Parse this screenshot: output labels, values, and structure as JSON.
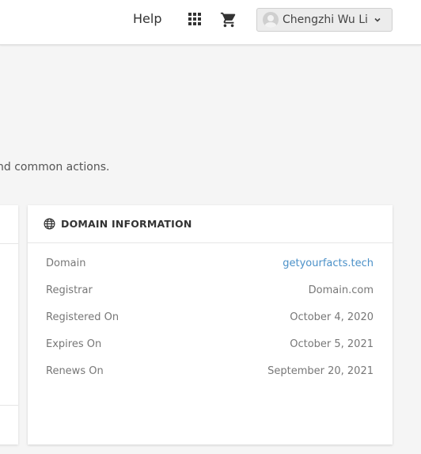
{
  "header": {
    "help_label": "Help",
    "apps_icon": "grid-icon",
    "cart_icon": "cart-icon",
    "user": {
      "name": "Chengzhi Wu Li",
      "avatar_icon": "user-avatar-icon",
      "dropdown_icon": "chevron-down-icon"
    }
  },
  "page": {
    "subtitle_fragment": "nd common actions."
  },
  "domain_card": {
    "icon": "globe-icon",
    "title": "DOMAIN INFORMATION",
    "rows": [
      {
        "label": "Domain",
        "value": "getyourfacts.tech",
        "is_link": true
      },
      {
        "label": "Registrar",
        "value": "Domain.com",
        "is_link": false
      },
      {
        "label": "Registered On",
        "value": "October 4, 2020",
        "is_link": false
      },
      {
        "label": "Expires On",
        "value": "October 5, 2021",
        "is_link": false
      },
      {
        "label": "Renews On",
        "value": "September 20, 2021",
        "is_link": false
      }
    ]
  },
  "colors": {
    "link": "#4a90c8",
    "background": "#f5f5f5",
    "card": "#ffffff"
  }
}
